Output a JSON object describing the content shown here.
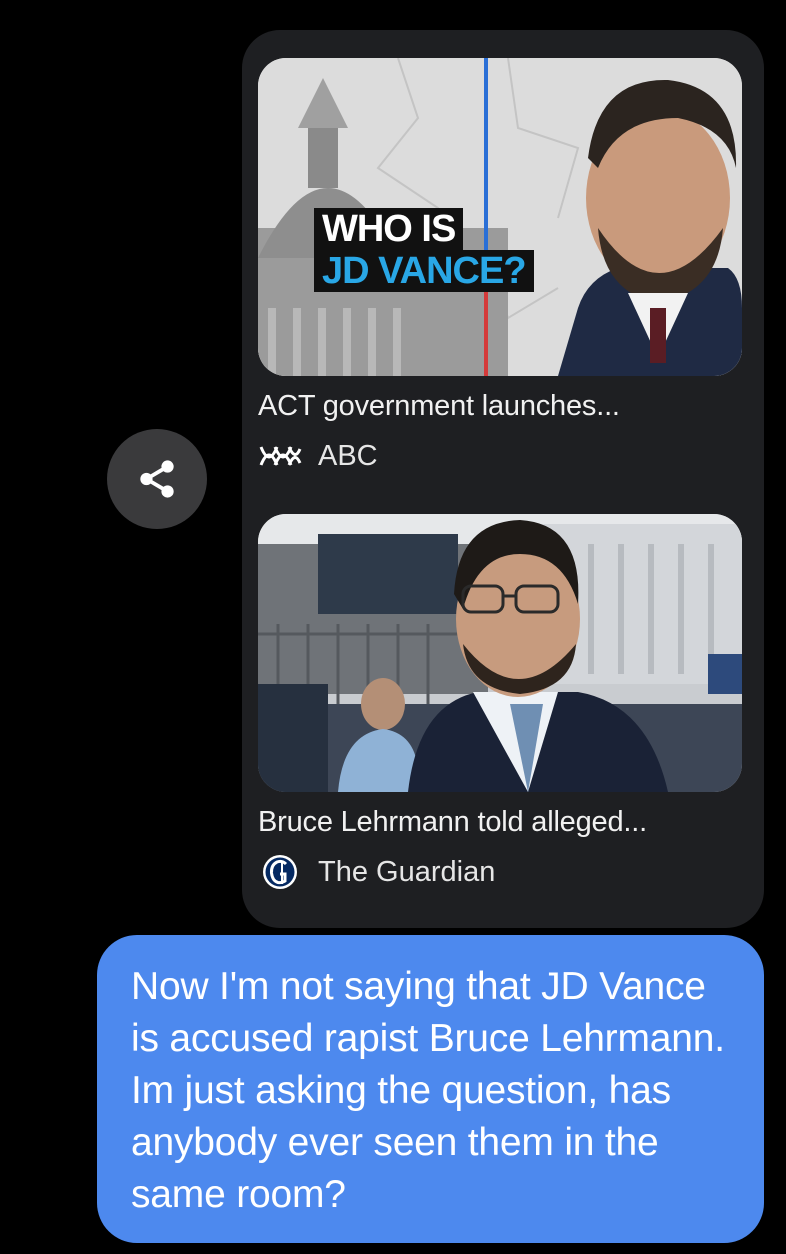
{
  "link_previews": [
    {
      "thumbnail_caption_lines": [
        "WHO IS",
        "JD VANCE?"
      ],
      "title": "ACT government launches...",
      "source_name": "ABC",
      "source_icon": "abc-logo-icon"
    },
    {
      "title": "Bruce Lehrmann told alleged...",
      "source_name": "The Guardian",
      "source_icon": "guardian-logo-icon"
    }
  ],
  "share_button": {
    "icon": "share-icon"
  },
  "message": {
    "text": "Now I'm not saying that JD Vance is accused rapist Bruce Lehrmann. Im just asking the question, has anybody ever seen them in the same room?"
  },
  "colors": {
    "background": "#000000",
    "card_background": "#1e1f22",
    "bubble_blue": "#4d89ee",
    "share_button_bg": "#3a3a3c"
  }
}
